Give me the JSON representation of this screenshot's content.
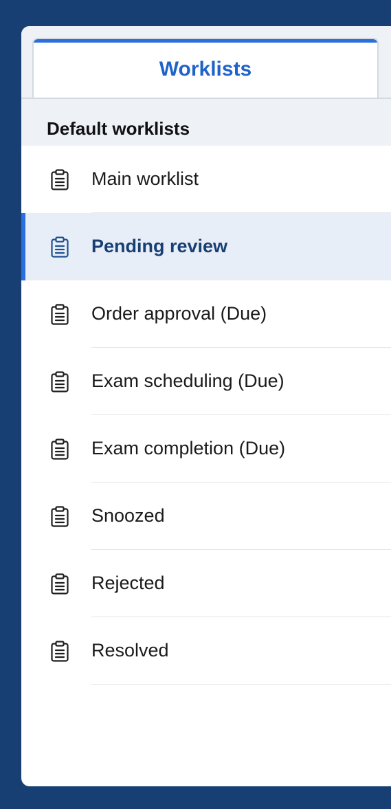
{
  "tabs": {
    "active_label": "Worklists"
  },
  "section": {
    "title": "Default worklists"
  },
  "items": [
    {
      "label": "Main worklist",
      "icon": "clipboard-icon",
      "active": false
    },
    {
      "label": "Pending review",
      "icon": "clipboard-icon",
      "active": true
    },
    {
      "label": "Order approval (Due)",
      "icon": "clipboard-icon",
      "active": false
    },
    {
      "label": "Exam scheduling (Due)",
      "icon": "clipboard-icon",
      "active": false
    },
    {
      "label": "Exam completion (Due)",
      "icon": "clipboard-icon",
      "active": false
    },
    {
      "label": "Snoozed",
      "icon": "clipboard-icon",
      "active": false
    },
    {
      "label": "Rejected",
      "icon": "clipboard-icon",
      "active": false
    },
    {
      "label": "Resolved",
      "icon": "clipboard-icon",
      "active": false
    }
  ],
  "colors": {
    "background": "#173f73",
    "accent": "#2a6fdb",
    "active_row": "#e8eef8",
    "active_text": "#173f73",
    "tab_text": "#1f63c9"
  }
}
